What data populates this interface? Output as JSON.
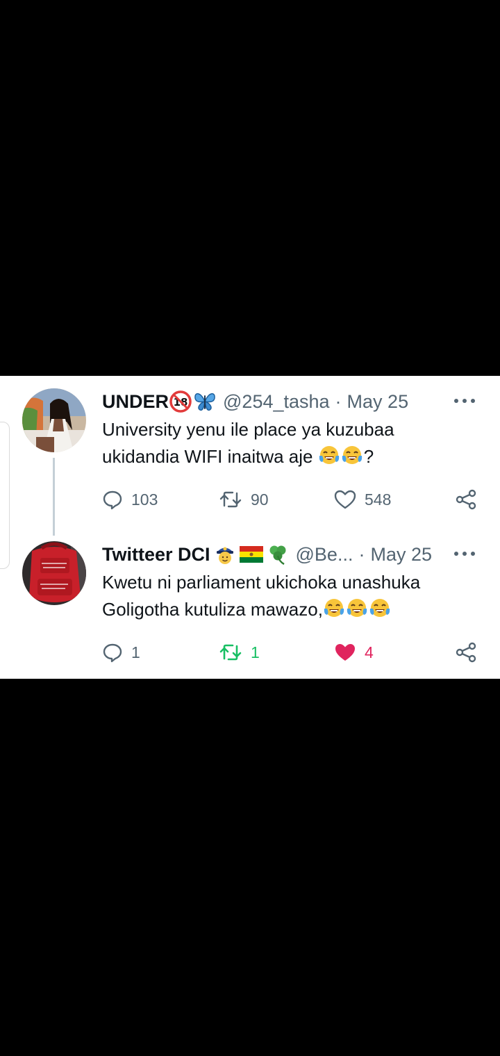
{
  "tweets": [
    {
      "display_name": "UNDER",
      "badges": [
        "18-prohibited-icon",
        "butterfly-emoji"
      ],
      "handle": "@254_tasha",
      "separator": "·",
      "date": "May 25",
      "text_line1": "University yenu ile place ya kuzubaa",
      "text_line2": "ukidandia WIFI inaitwa aje",
      "text_line2_suffix": "?",
      "emoji_count": 2,
      "replies": "103",
      "retweets": "90",
      "likes": "548",
      "liked": false,
      "retweeted": false
    },
    {
      "display_name": "Twitteer DCI",
      "badges": [
        "police-officer-emoji",
        "bolivia-flag-emoji",
        "shamrock-emoji"
      ],
      "handle": "@Be...",
      "separator": "·",
      "date": "May 25",
      "text_line1": "Kwetu ni parliament ukichoka unashuka",
      "text_line2": "Goligotha kutuliza mawazo,",
      "text_line2_suffix": "",
      "emoji_count": 3,
      "replies": "1",
      "retweets": "1",
      "likes": "4",
      "liked": true,
      "retweeted": true
    }
  ],
  "colors": {
    "background": "#000000",
    "card": "#ffffff",
    "text_primary": "#0f1419",
    "text_secondary": "#536471",
    "like_active": "#e0245e",
    "retweet_active": "#17bf63",
    "thread_line": "#c4cfd6"
  }
}
